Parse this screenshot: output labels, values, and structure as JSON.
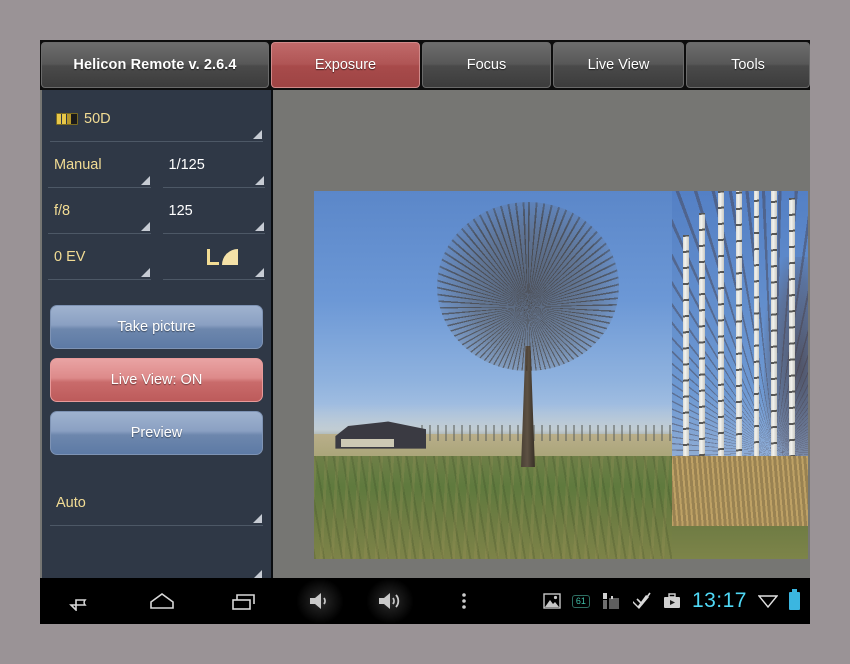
{
  "app": {
    "title": "Helicon Remote v. 2.6.4",
    "accent_red": "#b05555",
    "sidebar_bg": "#2f3846",
    "label_yellow": "#f2dc94"
  },
  "tabs": [
    {
      "label": "Exposure",
      "active": true,
      "name": "tab-exposure"
    },
    {
      "label": "Focus",
      "active": false,
      "name": "tab-focus"
    },
    {
      "label": "Live View",
      "active": false,
      "name": "tab-live-view"
    },
    {
      "label": "Tools",
      "active": false,
      "name": "tab-tools"
    }
  ],
  "sidebar": {
    "camera": {
      "label": "50D",
      "icon": "battery-level-icon"
    },
    "mode": {
      "label": "Manual"
    },
    "shutter": {
      "label": "1/125"
    },
    "aperture": {
      "label": "f/8"
    },
    "iso": {
      "label": "125"
    },
    "exposure_compensation": {
      "label": "0 EV"
    },
    "metering": {
      "icon": "metering-mode-icon"
    },
    "white_balance": {
      "label": "Auto"
    },
    "extra": {
      "label": ""
    },
    "buttons": [
      {
        "label": "Take picture",
        "style": "blue",
        "name": "take-picture-button"
      },
      {
        "label": "Live View: ON",
        "style": "red",
        "name": "live-view-toggle-button"
      },
      {
        "label": "Preview",
        "style": "blue",
        "name": "preview-button"
      }
    ]
  },
  "navbar": {
    "back": "back-icon",
    "home": "home-icon",
    "recents": "recents-icon",
    "volume_down": "volume-down-icon",
    "volume_up": "volume-up-icon",
    "overflow": "overflow-menu-icon",
    "status": {
      "gallery": "image-icon",
      "badge_count": "61",
      "usb": "usb-device-icon",
      "sync": "double-check-icon",
      "camera_app": "camera-bag-icon",
      "time": "13:17",
      "wifi": "wifi-icon",
      "battery": "battery-icon"
    }
  }
}
